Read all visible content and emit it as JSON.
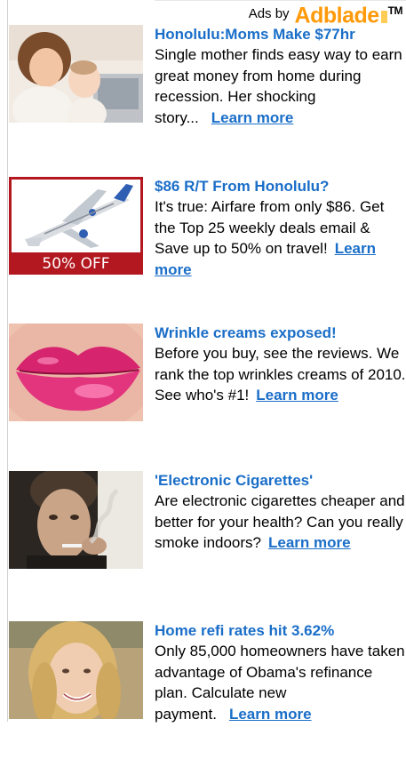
{
  "header": {
    "ads_by_label": "Ads by",
    "brand_logo": "Adblade",
    "brand_tm": "TM",
    "brand_color": "#ff9a0a"
  },
  "theme": {
    "link_color": "#1a6ec8",
    "text_color": "#000000"
  },
  "ads": [
    {
      "headline": "Honolulu:Moms Make $77hr",
      "body": "Single mother finds easy way to earn great money from home during recession. Her shocking story...",
      "cta": "Learn more",
      "image": "mother-and-baby-laptop"
    },
    {
      "headline": "$86 R/T From Honolulu?",
      "body": "It's true: Airfare from only $86. Get the Top 25 weekly deals email & Save up to 50% on travel!",
      "cta": "Learn more",
      "image": "airplane",
      "image_badge": "50% OFF"
    },
    {
      "headline": "Wrinkle creams exposed!",
      "body": "Before you buy, see the reviews. We rank the top wrinkles creams of 2010. See who's #1!",
      "cta": "Learn more",
      "image": "pink-lips"
    },
    {
      "headline": "'Electronic Cigarettes'",
      "body": "Are electronic cigarettes cheaper and better for your health? Can you really smoke indoors?",
      "cta": "Learn more",
      "image": "man-smoking"
    },
    {
      "headline": "Home refi rates hit 3.62%",
      "body": "Only 85,000 homeowners have taken advantage of Obama's refinance plan. Calculate new payment.",
      "cta": "Learn more",
      "image": "smiling-woman"
    }
  ]
}
